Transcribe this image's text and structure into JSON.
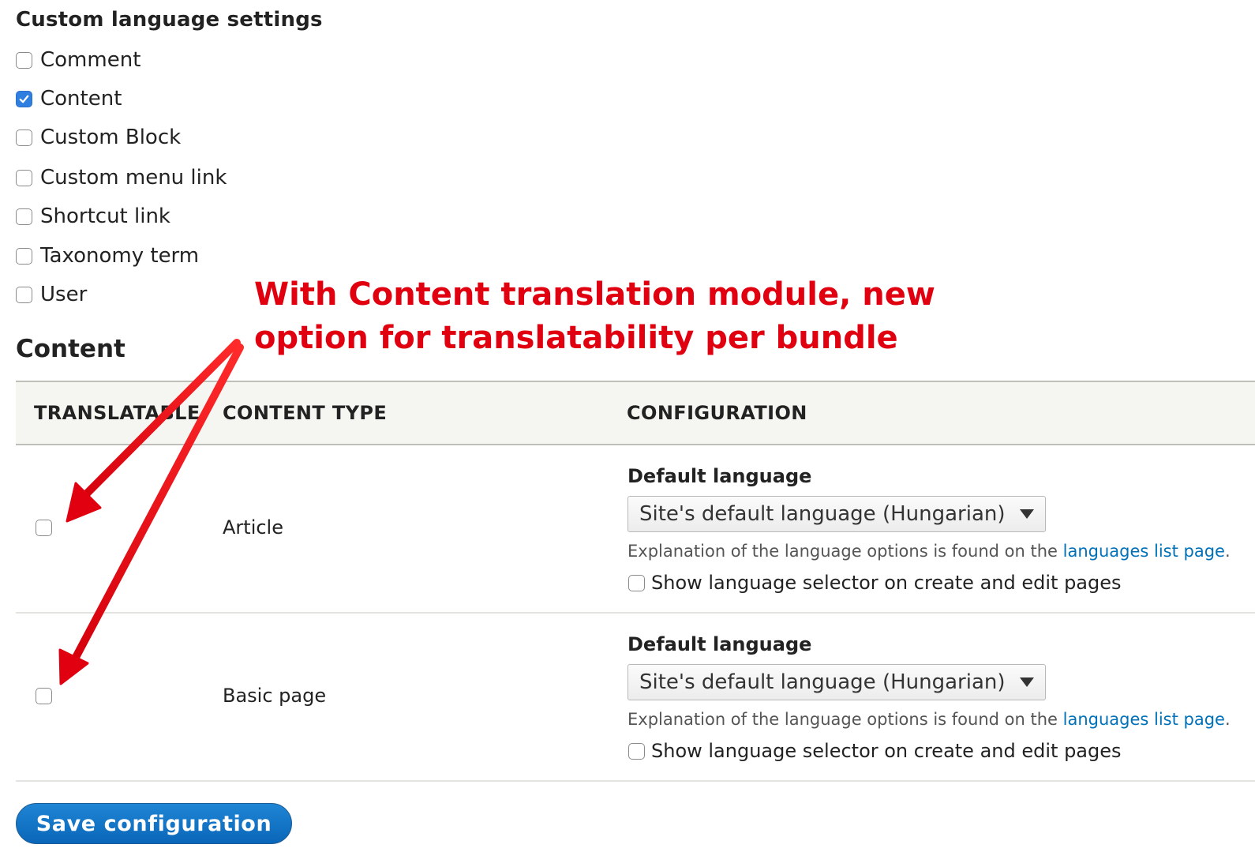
{
  "custom_language_settings": {
    "title": "Custom language settings",
    "items": [
      {
        "label": "Comment",
        "checked": false
      },
      {
        "label": "Content",
        "checked": true
      },
      {
        "label": "Custom Block",
        "checked": false
      },
      {
        "label": "Custom menu link",
        "checked": false
      },
      {
        "label": "Shortcut link",
        "checked": false
      },
      {
        "label": "Taxonomy term",
        "checked": false
      },
      {
        "label": "User",
        "checked": false
      }
    ]
  },
  "content_section": {
    "title": "Content",
    "columns": [
      "TRANSLATABLE",
      "CONTENT TYPE",
      "CONFIGURATION"
    ],
    "rows": [
      {
        "translatable": false,
        "content_type": "Article",
        "default_language_label": "Default language",
        "select_value": "Site's default language (Hungarian)",
        "description_prefix": "Explanation of the language options is found on the ",
        "description_link": "languages list page",
        "description_suffix": ".",
        "show_selector_label": "Show language selector on create and edit pages",
        "show_selector_checked": false
      },
      {
        "translatable": false,
        "content_type": "Basic page",
        "default_language_label": "Default language",
        "select_value": "Site's default language (Hungarian)",
        "description_prefix": "Explanation of the language options is found on the ",
        "description_link": "languages list page",
        "description_suffix": ".",
        "show_selector_label": "Show language selector on create and edit pages",
        "show_selector_checked": false
      }
    ]
  },
  "save_button": {
    "label": "Save configuration"
  },
  "annotation": {
    "line1": "With Content translation module, new",
    "line2": "option for translatability per bundle",
    "color": "#e00010"
  },
  "colors": {
    "accent": "#2f7fe0",
    "link": "#0071b8",
    "button": "#0a66b8"
  }
}
